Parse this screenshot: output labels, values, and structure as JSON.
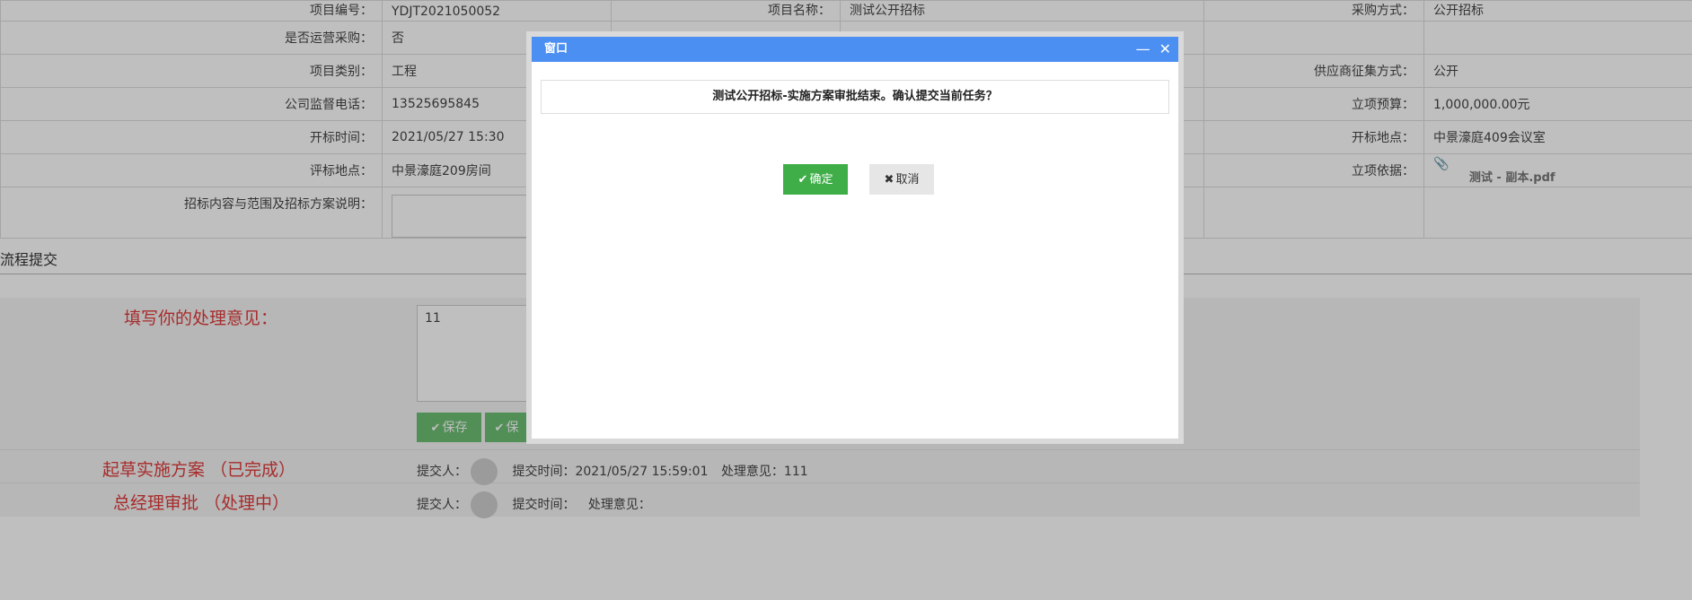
{
  "info": {
    "row0": {
      "l1": "项目编号：",
      "v1": "YDJT2021050052",
      "l2": "项目名称：",
      "v2": "测试公开招标",
      "l3": "采购方式：",
      "v3": "公开招标"
    },
    "row1": {
      "l1": "是否运营采购：",
      "v1": "否"
    },
    "row2": {
      "l1": "项目类别：",
      "v1": "工程",
      "l3": "供应商征集方式：",
      "v3": "公开"
    },
    "row3": {
      "l1": "公司监督电话：",
      "v1": "13525695845",
      "l3": "立项预算：",
      "v3": "1,000,000.00元"
    },
    "row4": {
      "l1": "开标时间：",
      "v1": "2021/05/27 15:30",
      "l3": "开标地点：",
      "v3": "中景濠庭409会议室"
    },
    "row5": {
      "l1": "评标地点：",
      "v1": "中景濠庭209房间",
      "l3": "立项依据：",
      "file": "测试 - 副本.pdf"
    },
    "row6": {
      "l1": "招标内容与范围及招标方案说明："
    }
  },
  "section": {
    "title": "流程提交"
  },
  "flow": {
    "opinion_label": "填写你的处理意见：",
    "opinion_value": "11",
    "save_label": "保存",
    "save2_label": "保",
    "step1": {
      "label": "起草实施方案 （已完成）",
      "submitter": "提交人：",
      "time": "提交时间：2021/05/27 15:59:01",
      "opinion": "处理意见：111"
    },
    "step2": {
      "label": "总经理审批 （处理中）",
      "submitter": "提交人：",
      "time": "提交时间：",
      "opinion": "处理意见："
    }
  },
  "modal": {
    "title": "窗口",
    "minimize": "—",
    "close": "✕",
    "message": "测试公开招标-实施方案审批结束。确认提交当前任务？",
    "ok_label": "确定",
    "cancel_label": "取消"
  },
  "colors": {
    "header": "#4b8ff2",
    "ok": "#3fae49",
    "flow_label": "#e03a3a"
  }
}
